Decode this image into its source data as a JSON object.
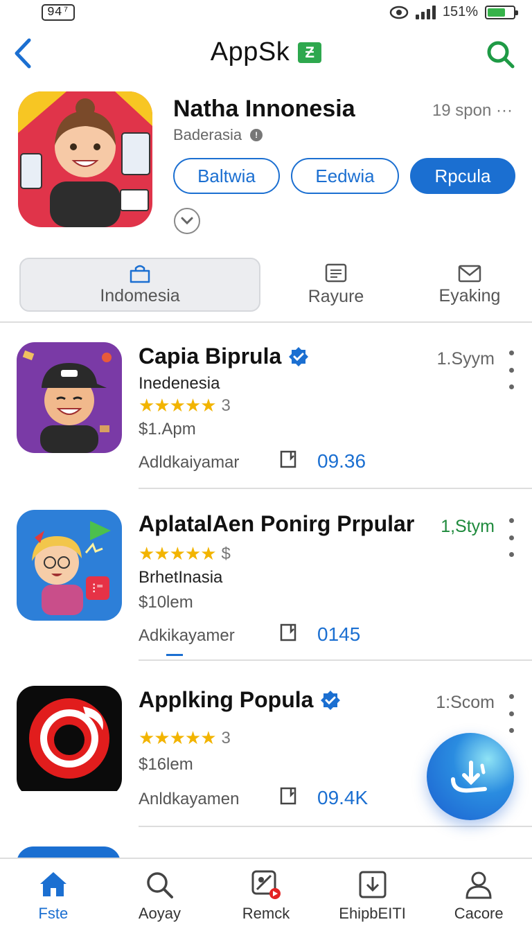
{
  "status_bar": {
    "time": "94⁷",
    "battery": "151%",
    "battery_level": 0.7
  },
  "header": {
    "title": "AppSk",
    "badge_glyph": "Ƶ"
  },
  "hero": {
    "name": "Natha Innonesia",
    "subtitle": "Baderasia",
    "meta": "19 spon ···",
    "pills": [
      "Baltwia",
      "Eedwia",
      "Rpcula"
    ]
  },
  "segments": [
    {
      "label": "Indomesia",
      "icon": "bag-icon",
      "active": true
    },
    {
      "label": "Rayure",
      "icon": "document-icon",
      "active": false
    },
    {
      "label": "Eyaking",
      "icon": "mail-icon",
      "active": false
    }
  ],
  "apps": [
    {
      "name": "Capia Biprula",
      "verified": true,
      "meta": "1.Syym",
      "line": "Inedenesia",
      "stars": "★★★★★",
      "rating_count": "3",
      "price": "$1.Apm",
      "developer": "Adldkaiyamar",
      "count": "09.36"
    },
    {
      "name": "AplatalAen Ponirg Prpular",
      "verified": false,
      "meta": "1,Stym",
      "stars": "★★★★★",
      "rating_count": "$",
      "line": "BrhetInasia",
      "price": "$10lem",
      "developer": "Adkikayamer",
      "count": "0145"
    },
    {
      "name": "Applking Popula",
      "verified": true,
      "meta": "1:Scom",
      "stars": "★★★★★",
      "rating_count": "3",
      "price": "$16lem",
      "developer": "Anldkayamen",
      "count": "09.4K"
    }
  ],
  "bottom_nav": [
    {
      "label": "Fste",
      "icon": "home-icon",
      "active": true
    },
    {
      "label": "Aoyay",
      "icon": "search-icon",
      "active": false
    },
    {
      "label": "Remck",
      "icon": "media-icon",
      "active": false
    },
    {
      "label": "EhipbEITI",
      "icon": "download-icon",
      "active": false
    },
    {
      "label": "Cacore",
      "icon": "profile-icon",
      "active": false
    }
  ],
  "colors": {
    "accent": "#1b6fd1",
    "green": "#2ea84e",
    "star": "#f2b400"
  }
}
